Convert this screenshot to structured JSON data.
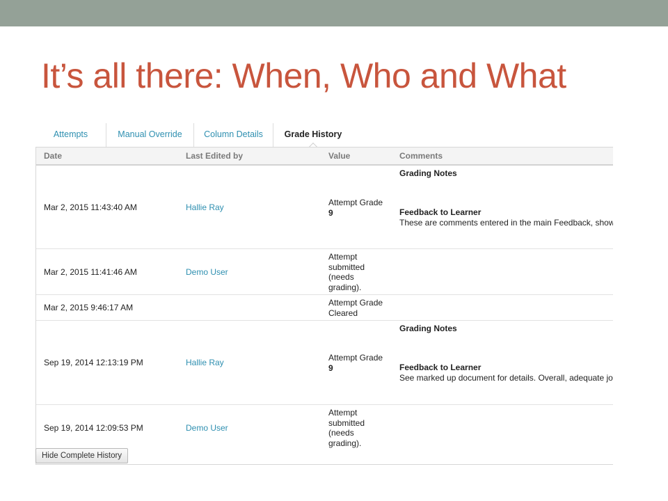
{
  "slide": {
    "title": "It’s all there: When, Who and What"
  },
  "tabs": [
    {
      "label": "Attempts",
      "active": false
    },
    {
      "label": "Manual Override",
      "active": false
    },
    {
      "label": "Column Details",
      "active": false
    },
    {
      "label": "Grade History",
      "active": true
    }
  ],
  "table": {
    "columns": [
      "Date",
      "Last Edited by",
      "Value",
      "Comments"
    ],
    "rows": [
      {
        "date": "Mar 2, 2015 11:43:40 AM",
        "user": "Hallie Ray",
        "value_lines": [
          "Attempt Grade"
        ],
        "value_bold": "9",
        "grading_notes_label": "Grading Notes",
        "feedback_label": "Feedback to Learner",
        "feedback_text": "These are comments entered in the main Feedback, show"
      },
      {
        "date": "Mar 2, 2015 11:41:46 AM",
        "user": "Demo User",
        "value_lines": [
          "Attempt",
          "submitted",
          "(needs",
          "grading)."
        ]
      },
      {
        "date": "Mar 2, 2015 9:46:17 AM",
        "user": "",
        "value_lines": [
          "Attempt Grade",
          "Cleared"
        ]
      },
      {
        "date": "Sep 19, 2014 12:13:19 PM",
        "user": "Hallie Ray",
        "value_lines": [
          "Attempt Grade"
        ],
        "value_bold": "9",
        "grading_notes_label": "Grading Notes",
        "feedback_label": "Feedback to Learner",
        "feedback_text": "See marked up document for details. Overall, adequate jo"
      },
      {
        "date": "Sep 19, 2014 12:09:53 PM",
        "user": "Demo User",
        "value_lines": [
          "Attempt",
          "submitted",
          "(needs",
          "grading)."
        ]
      }
    ]
  },
  "footer": {
    "hide_button_label": "Hide Complete History"
  },
  "colors": {
    "top_bar": "#94a197",
    "title": "#c8553d",
    "link": "#2e8fb0"
  }
}
